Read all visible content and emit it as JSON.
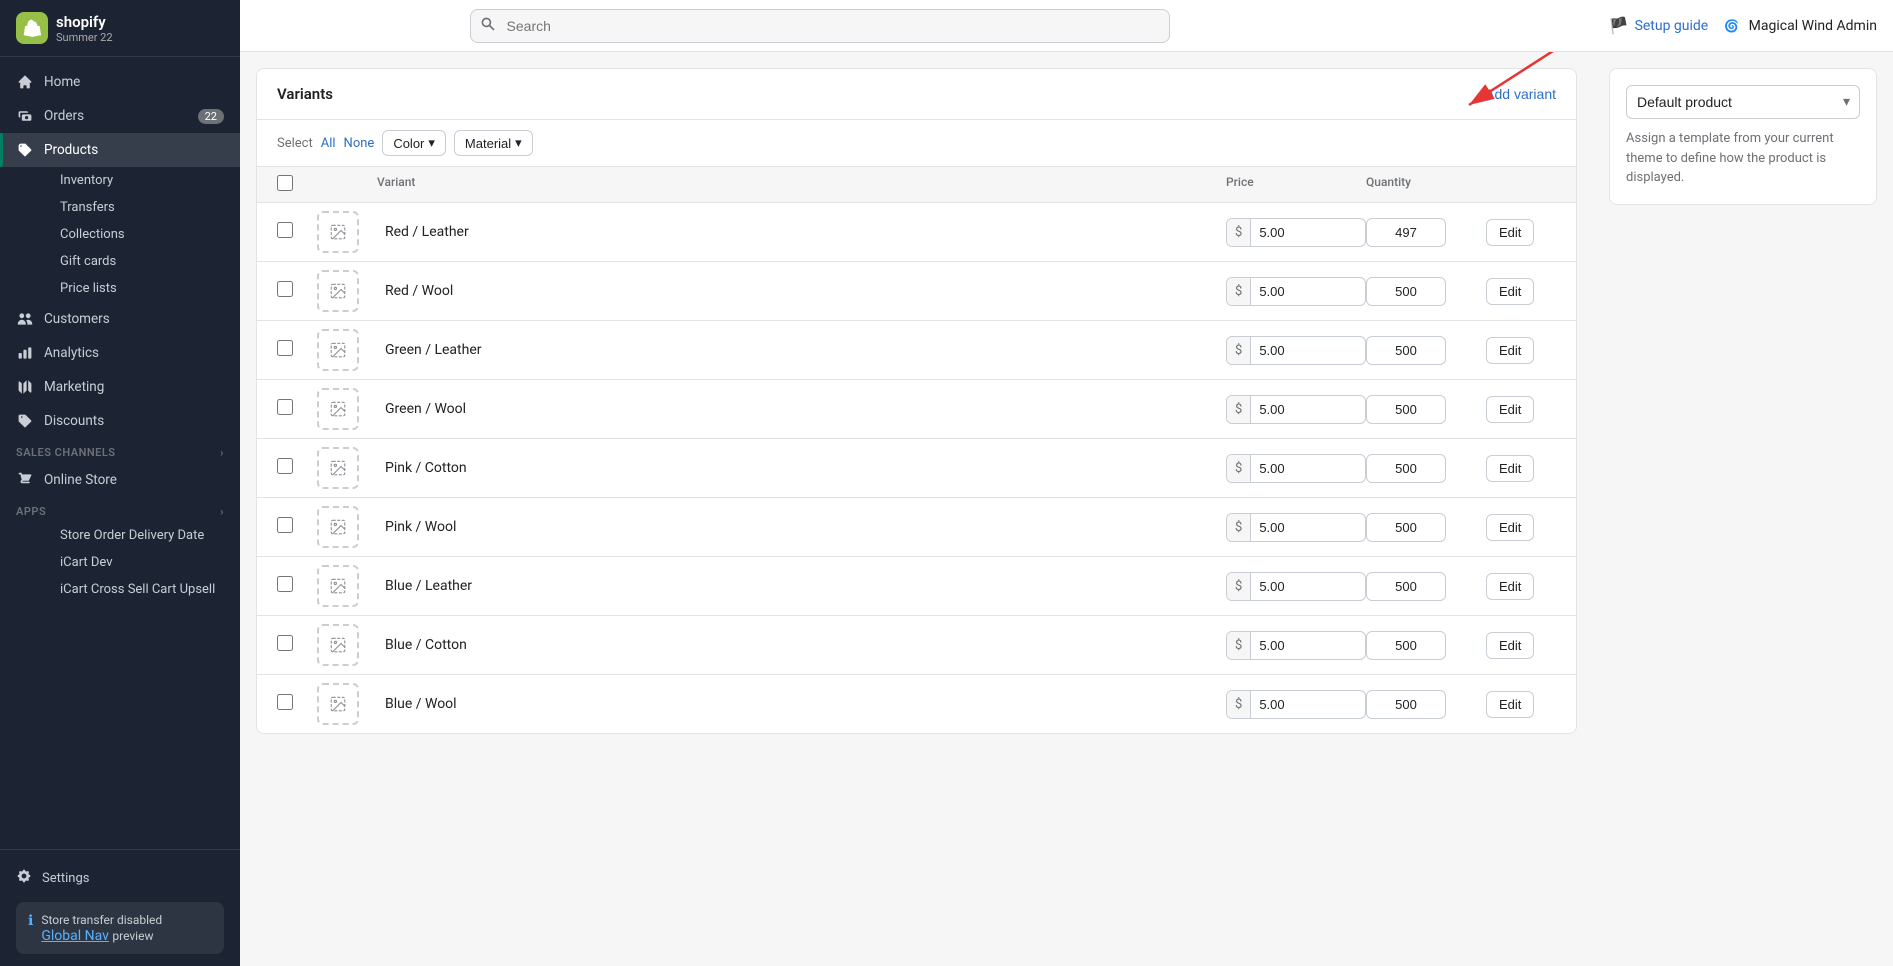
{
  "sidebar": {
    "logo": "S",
    "brand": "shopify",
    "badge": "Summer 22",
    "nav_items": [
      {
        "id": "home",
        "label": "Home",
        "icon": "home",
        "active": false
      },
      {
        "id": "orders",
        "label": "Orders",
        "icon": "orders",
        "active": false,
        "badge": "22"
      },
      {
        "id": "products",
        "label": "Products",
        "icon": "products",
        "active": true
      },
      {
        "id": "customers",
        "label": "Customers",
        "icon": "customers",
        "active": false
      },
      {
        "id": "analytics",
        "label": "Analytics",
        "icon": "analytics",
        "active": false
      },
      {
        "id": "marketing",
        "label": "Marketing",
        "icon": "marketing",
        "active": false
      },
      {
        "id": "discounts",
        "label": "Discounts",
        "icon": "discounts",
        "active": false
      }
    ],
    "products_sub": [
      {
        "id": "inventory",
        "label": "Inventory",
        "active": false
      },
      {
        "id": "transfers",
        "label": "Transfers",
        "active": false
      },
      {
        "id": "collections",
        "label": "Collections",
        "active": false
      },
      {
        "id": "gift-cards",
        "label": "Gift cards",
        "active": false
      },
      {
        "id": "price-lists",
        "label": "Price lists",
        "active": false
      }
    ],
    "sales_channels_label": "Sales channels",
    "online_store": "Online Store",
    "apps_label": "Apps",
    "apps_items": [
      {
        "id": "store-order-delivery",
        "label": "Store Order Delivery Date"
      },
      {
        "id": "icart-dev",
        "label": "iCart Dev"
      },
      {
        "id": "icart-cross-sell",
        "label": "iCart Cross Sell Cart Upsell"
      }
    ],
    "settings": "Settings",
    "store_transfer": "Store transfer disabled",
    "global_nav": "Global Nav",
    "preview": "preview"
  },
  "topbar": {
    "search_placeholder": "Search",
    "setup_guide": "Setup guide",
    "admin_name": "Magical Wind Admin"
  },
  "variants": {
    "title": "Variants",
    "add_variant_btn": "Add variant",
    "filter": {
      "select_label": "Select",
      "all_label": "All",
      "none_label": "None",
      "color_label": "Color",
      "material_label": "Material"
    },
    "columns": {
      "variant": "Variant",
      "price": "Price",
      "quantity": "Quantity"
    },
    "rows": [
      {
        "id": "red-leather",
        "name": "Red / Leather",
        "price": "5.00",
        "quantity": "497"
      },
      {
        "id": "red-wool",
        "name": "Red / Wool",
        "price": "5.00",
        "quantity": "500"
      },
      {
        "id": "green-leather",
        "name": "Green / Leather",
        "price": "5.00",
        "quantity": "500"
      },
      {
        "id": "green-wool",
        "name": "Green / Wool",
        "price": "5.00",
        "quantity": "500"
      },
      {
        "id": "pink-cotton",
        "name": "Pink / Cotton",
        "price": "5.00",
        "quantity": "500"
      },
      {
        "id": "pink-wool",
        "name": "Pink / Wool",
        "price": "5.00",
        "quantity": "500"
      },
      {
        "id": "blue-leather",
        "name": "Blue / Leather",
        "price": "5.00",
        "quantity": "500"
      },
      {
        "id": "blue-cotton",
        "name": "Blue / Cotton",
        "price": "5.00",
        "quantity": "500"
      },
      {
        "id": "blue-wool",
        "name": "Blue / Wool",
        "price": "5.00",
        "quantity": "500"
      }
    ],
    "edit_btn": "Edit",
    "currency_prefix": "$"
  },
  "template": {
    "select_value": "Default product",
    "description": "Assign a template from your current theme to define how the product is displayed."
  }
}
